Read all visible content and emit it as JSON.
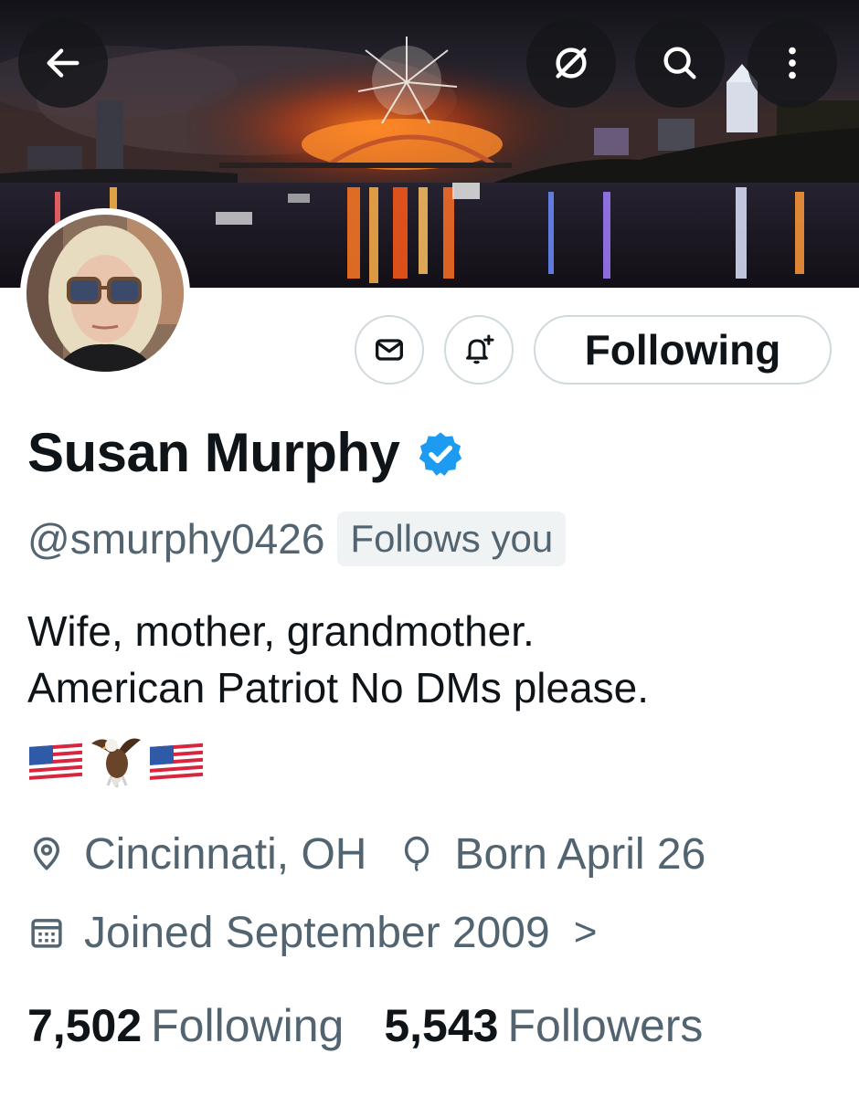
{
  "header": {
    "back_icon": "arrow-left-icon",
    "grok_icon": "slash-circle-icon",
    "search_icon": "search-icon",
    "more_icon": "more-vertical-icon"
  },
  "actions": {
    "message_icon": "mail-icon",
    "notify_icon": "bell-plus-icon",
    "following_label": "Following"
  },
  "profile": {
    "display_name": "Susan Murphy",
    "verified_icon": "verified-badge-icon",
    "handle": "@smurphy0426",
    "follows_you": "Follows you",
    "bio_line1": "Wife, mother, grandmother.",
    "bio_line2": "American Patriot No DMs please.",
    "bio_emojis": [
      "flag-us",
      "eagle",
      "flag-us"
    ],
    "location": "Cincinnati, OH",
    "birthday": "Born April 26",
    "joined": "Joined September 2009",
    "joined_chevron": ">"
  },
  "stats": {
    "following_count": "7,502",
    "following_label": "Following",
    "followers_count": "5,543",
    "followers_label": "Followers"
  },
  "colors": {
    "text": "#0f1419",
    "secondary": "#536471",
    "verified": "#1d9bf0",
    "border": "#cfd9de"
  }
}
